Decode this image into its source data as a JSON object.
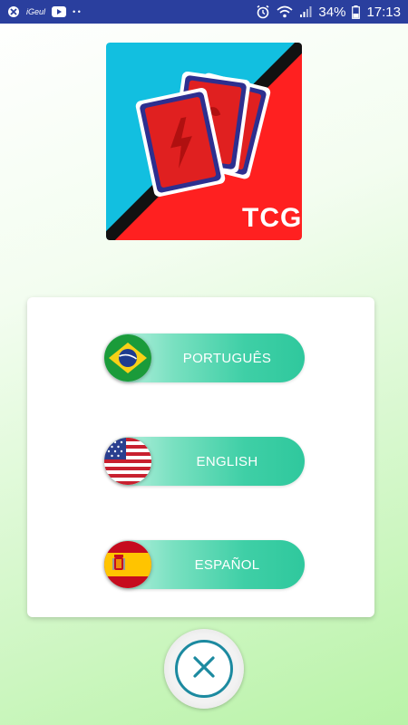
{
  "status_bar": {
    "left_icons": [
      "signal-off-icon",
      "carrier-logo-icon",
      "youtube-icon",
      "more-dots-icon"
    ],
    "carrier_text": "iGeul",
    "dots_text": "• •",
    "right_icons": [
      "alarm-icon",
      "wifi-icon",
      "cell-signal-icon",
      "battery-icon"
    ],
    "battery": "34%",
    "time": "17:13"
  },
  "logo": {
    "text": "TCG",
    "colors": {
      "left": "#12bfe0",
      "right": "#ff2020",
      "stripe": "#111111",
      "card": "#e02020",
      "card_border": "#2d2f8f"
    }
  },
  "languages": [
    {
      "label": "PORTUGUÊS",
      "flag": "brazil-flag-icon"
    },
    {
      "label": "ENGLISH",
      "flag": "usa-flag-icon"
    },
    {
      "label": "ESPAÑOL",
      "flag": "spain-flag-icon"
    }
  ],
  "close": {
    "icon": "close-icon",
    "color": "#1c8aa0"
  },
  "accent_gradient": [
    "#c9f5e7",
    "#2fc89d"
  ]
}
